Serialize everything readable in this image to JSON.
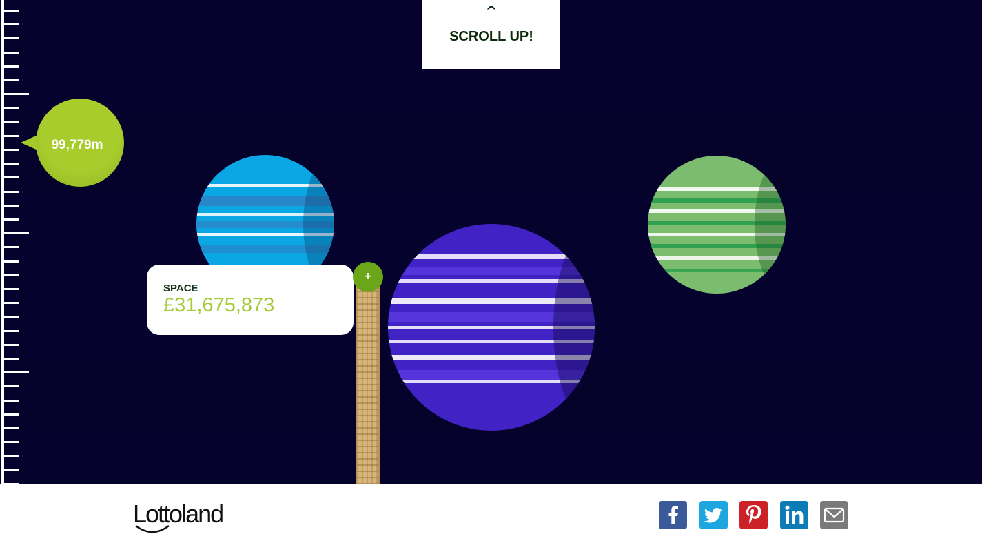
{
  "scroll_up": {
    "caret": "^",
    "label": "SCROLL UP!"
  },
  "altitude": {
    "label": "99,779m"
  },
  "info_card": {
    "title": "SPACE",
    "value": "£31,675,873",
    "expand_label": "+"
  },
  "footer": {
    "logo_text": "Lottoland",
    "share": [
      {
        "name": "facebook",
        "icon": "facebook-icon",
        "color": "#3b5a9a"
      },
      {
        "name": "twitter",
        "icon": "twitter-icon",
        "color": "#1da6e0"
      },
      {
        "name": "pinterest",
        "icon": "pinterest-icon",
        "color": "#cc2127"
      },
      {
        "name": "linkedin",
        "icon": "linkedin-icon",
        "color": "#0c7bb6"
      },
      {
        "name": "email",
        "icon": "email-icon",
        "color": "#7a7a7a"
      }
    ]
  },
  "colors": {
    "sky": "#06022e",
    "accent_green": "#a5c92b",
    "planet_blue": "#0aa7e4",
    "planet_purple": "#4022c5",
    "planet_green": "#7bbc6e"
  }
}
